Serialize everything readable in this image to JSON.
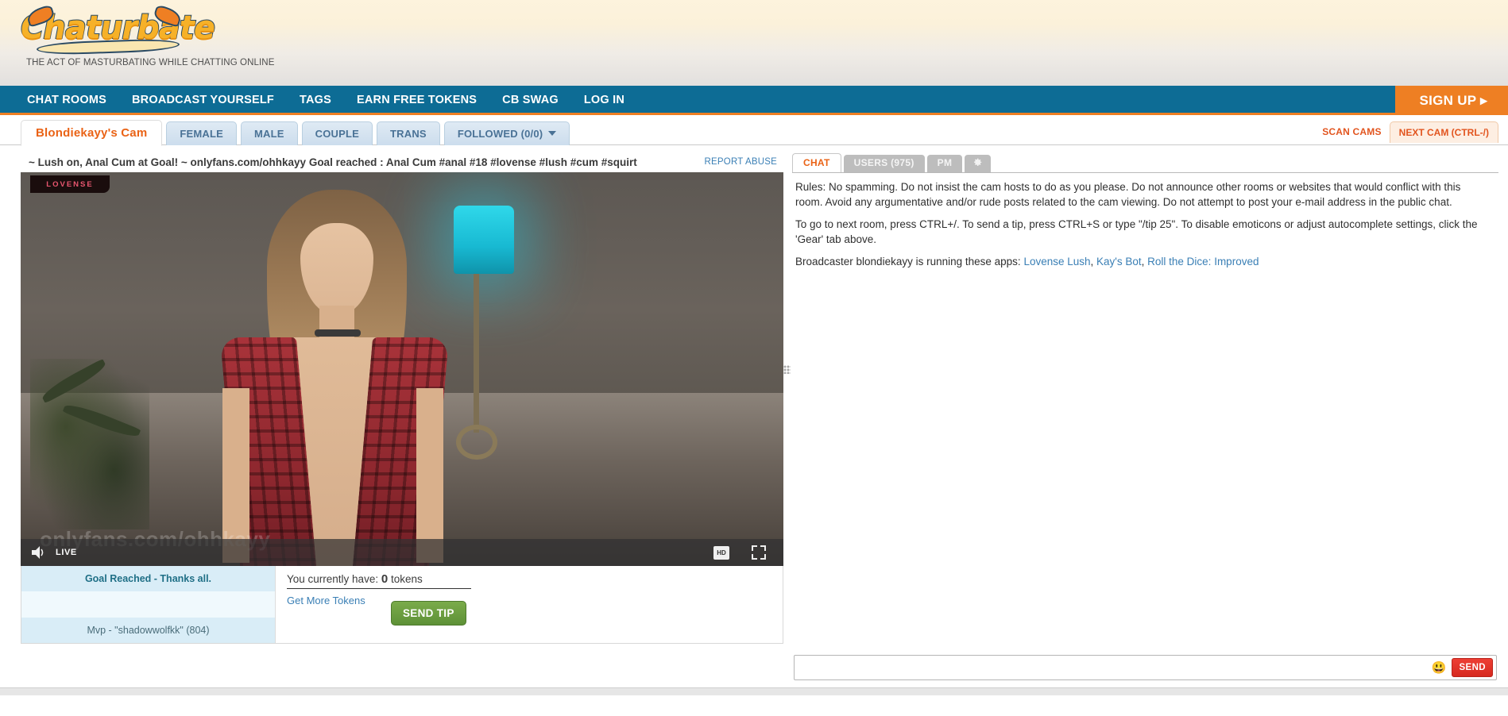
{
  "header": {
    "logo_text": "Chaturbate",
    "tagline": "THE ACT OF MASTURBATING WHILE CHATTING ONLINE"
  },
  "nav": {
    "items": [
      {
        "label": "CHAT ROOMS",
        "name": "nav-chat-rooms"
      },
      {
        "label": "BROADCAST YOURSELF",
        "name": "nav-broadcast-yourself"
      },
      {
        "label": "TAGS",
        "name": "nav-tags"
      },
      {
        "label": "EARN FREE TOKENS",
        "name": "nav-earn-free-tokens"
      },
      {
        "label": "CB SWAG",
        "name": "nav-cb-swag"
      },
      {
        "label": "LOG IN",
        "name": "nav-log-in"
      }
    ],
    "signup_label": "SIGN UP ▸"
  },
  "tabs": {
    "items": [
      {
        "label": "Blondiekayy's Cam",
        "active": true
      },
      {
        "label": "FEMALE",
        "active": false
      },
      {
        "label": "MALE",
        "active": false
      },
      {
        "label": "COUPLE",
        "active": false
      },
      {
        "label": "TRANS",
        "active": false
      },
      {
        "label": "FOLLOWED (0/0)",
        "active": false,
        "caret": true
      }
    ],
    "scan_cams": "SCAN CAMS",
    "next_cam": "NEXT CAM (CTRL-/)"
  },
  "room": {
    "topic": "~ Lush on, Anal Cum at Goal! ~ onlyfans.com/ohhkayy Goal reached : Anal Cum #anal #18 #lovense #lush #cum #squirt",
    "report_abuse": "REPORT ABUSE"
  },
  "video": {
    "lovense_badge": "LOVENSE",
    "live_label": "LIVE",
    "watermark": "onlyfans.com/ohhkayy",
    "hd_label": "HD",
    "volume_icon": "speaker-icon",
    "fullscreen_icon": "fullscreen-icon"
  },
  "goal": {
    "row1": "Goal Reached - Thanks all.",
    "row2": "",
    "row3": "Mvp - \"shadowwolfkk\" (804)"
  },
  "tip": {
    "tokens_prefix": "You currently have:",
    "tokens_count": "0",
    "tokens_suffix": "tokens",
    "get_more": "Get More Tokens",
    "send_tip_label": "SEND TIP"
  },
  "chat": {
    "tabs": [
      {
        "label": "CHAT",
        "active": true,
        "name": "tab-chat"
      },
      {
        "label": "USERS (975)",
        "active": false,
        "name": "tab-users"
      },
      {
        "label": "PM",
        "active": false,
        "name": "tab-pm"
      }
    ],
    "gear_tab_name": "tab-settings-gear",
    "messages": {
      "rules": "Rules: No spamming. Do not insist the cam hosts to do as you please. Do not announce other rooms or websites that would conflict with this room. Avoid any argumentative and/or rude posts related to the cam viewing. Do not attempt to post your e-mail address in the public chat.",
      "shortcuts": "To go to next room, press CTRL+/. To send a tip, press CTRL+S or type \"/tip 25\". To disable emoticons or adjust autocomplete settings, click the 'Gear' tab above.",
      "apps_prefix": "Broadcaster blondiekayy is running these apps: ",
      "apps": [
        {
          "label": "Lovense Lush"
        },
        {
          "label": "Kay's Bot"
        },
        {
          "label": "Roll the Dice: Improved"
        }
      ]
    },
    "input_placeholder": "",
    "input_value": "",
    "emoji_icon": "smiley-icon",
    "send_label": "SEND"
  },
  "colors": {
    "nav_blue": "#0d6c95",
    "accent_orange": "#ee7f23",
    "link_orange": "#ea6316",
    "link_blue": "#3a7fb5",
    "tip_green": "#5e9137",
    "send_red": "#d6291f"
  }
}
